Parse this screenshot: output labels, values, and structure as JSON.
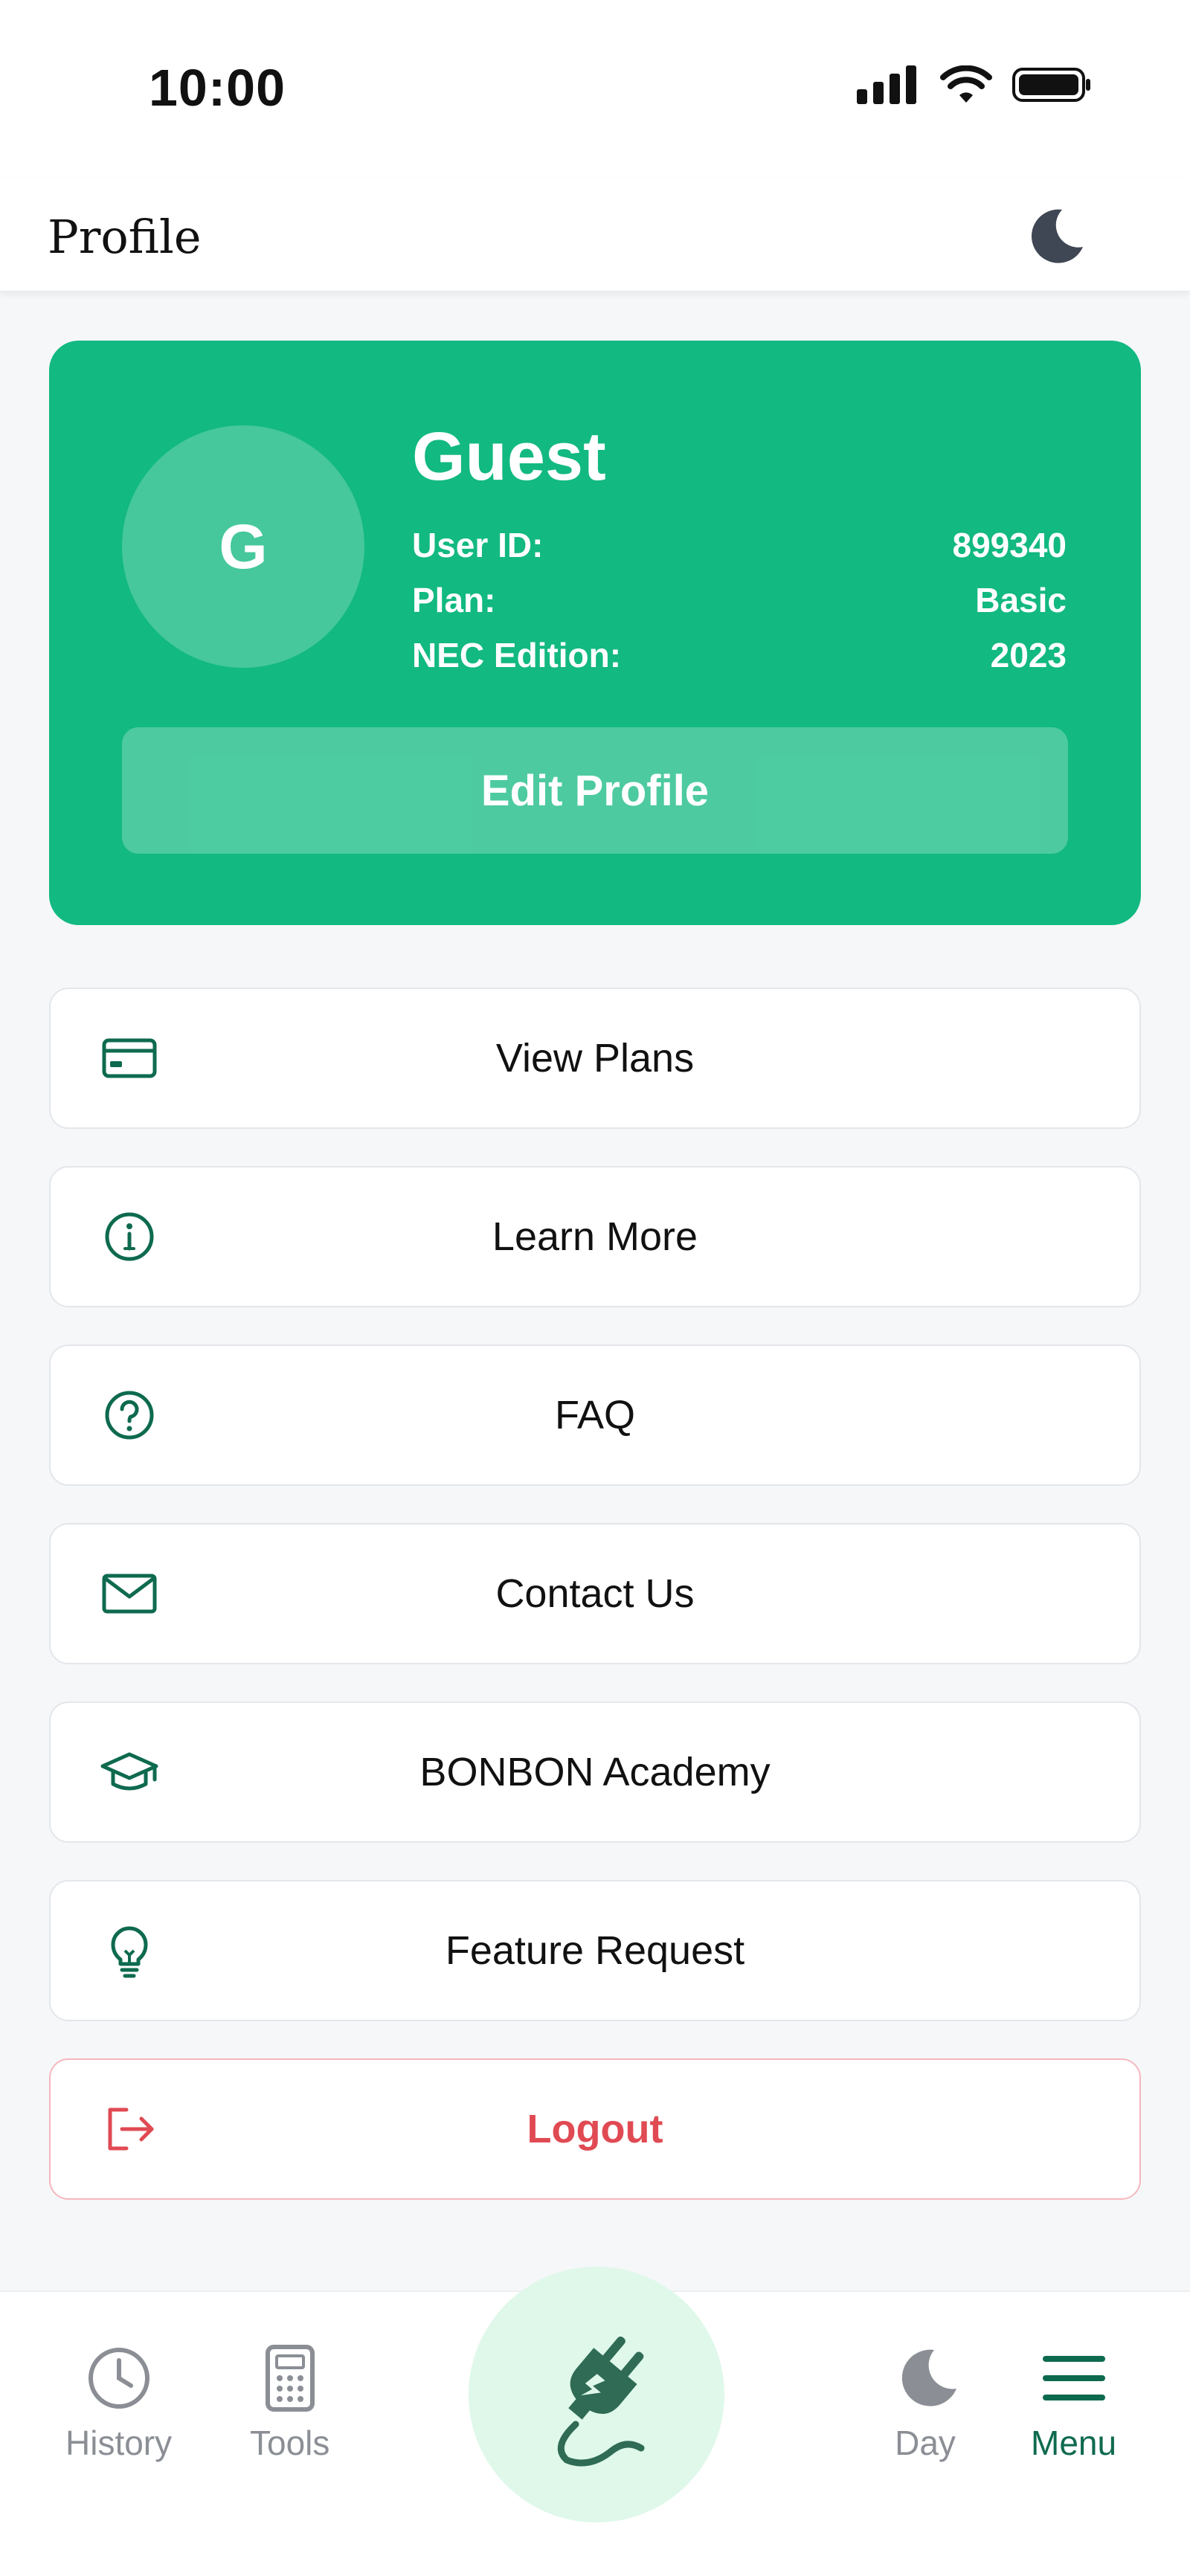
{
  "status": {
    "time": "10:00"
  },
  "header": {
    "title": "Profile",
    "theme_icon": "moon-icon"
  },
  "profile": {
    "avatar_initial": "G",
    "name": "Guest",
    "rows": [
      {
        "label": "User ID:",
        "value": "899340"
      },
      {
        "label": "Plan:",
        "value": "Basic"
      },
      {
        "label": "NEC Edition:",
        "value": "2023"
      }
    ],
    "edit_button": "Edit Profile"
  },
  "menu": {
    "items": [
      {
        "label": "View Plans",
        "icon": "credit-card-icon"
      },
      {
        "label": "Learn More",
        "icon": "info-icon"
      },
      {
        "label": "FAQ",
        "icon": "help-icon"
      },
      {
        "label": "Contact Us",
        "icon": "mail-icon"
      },
      {
        "label": "BONBON Academy",
        "icon": "graduation-cap-icon"
      },
      {
        "label": "Feature Request",
        "icon": "lightbulb-icon"
      }
    ],
    "logout": {
      "label": "Logout",
      "icon": "logout-icon"
    }
  },
  "bottom_nav": {
    "history": "History",
    "tools": "Tools",
    "day": "Day",
    "menu": "Menu"
  },
  "colors": {
    "accent": "#12b981",
    "accent_dark": "#0e6a4f",
    "danger": "#e04a53"
  }
}
